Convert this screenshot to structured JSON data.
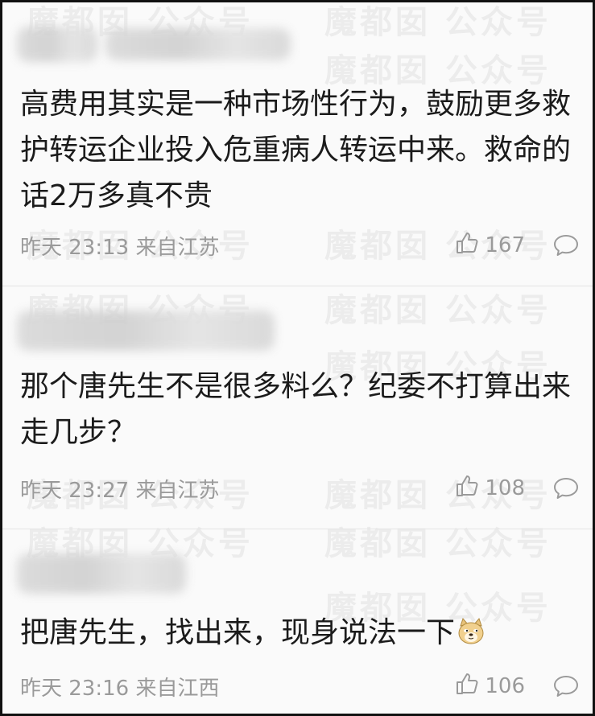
{
  "watermark_text": "魔都囡 公众号",
  "comments": [
    {
      "text": "高费用其实是一种市场性行为，鼓励更多救护转运企业投入危重病人转运中来。救命的话2万多真不贵",
      "time": "昨天 23:13 来自江苏",
      "likes": "167"
    },
    {
      "text": "那个唐先生不是很多料么？纪委不打算出来走几步？",
      "time": "昨天 23:27 来自江苏",
      "likes": "108"
    },
    {
      "text": "把唐先生，找出来，现身说法一下",
      "emoji": "doge-emoji-icon",
      "time": "昨天 23:16 来自江西",
      "likes": "106"
    }
  ],
  "colors": {
    "text": "#1b1b1b",
    "meta": "#9a9a9a",
    "border": "#111111",
    "background": "#fafafa"
  }
}
